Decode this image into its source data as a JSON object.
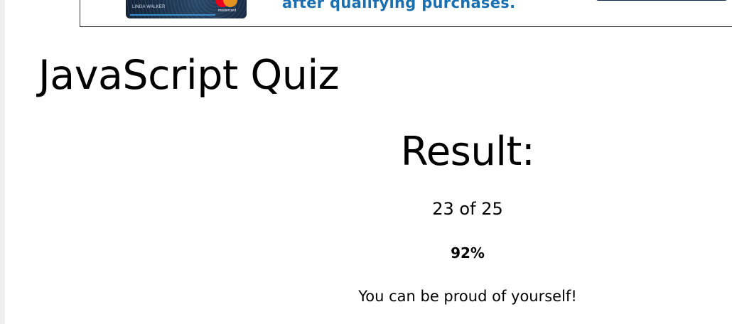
{
  "ad": {
    "card_holder": "LINDA WALKER",
    "card_brand": "mastercard",
    "text": "after qualifying purchases.",
    "colors": {
      "text": "#1a6fb0",
      "button": "#0b2a4a"
    }
  },
  "quiz": {
    "title": "JavaScript Quiz"
  },
  "result": {
    "heading": "Result:",
    "score": "23 of 25",
    "percent": "92%",
    "message": "You can be proud of yourself!"
  }
}
